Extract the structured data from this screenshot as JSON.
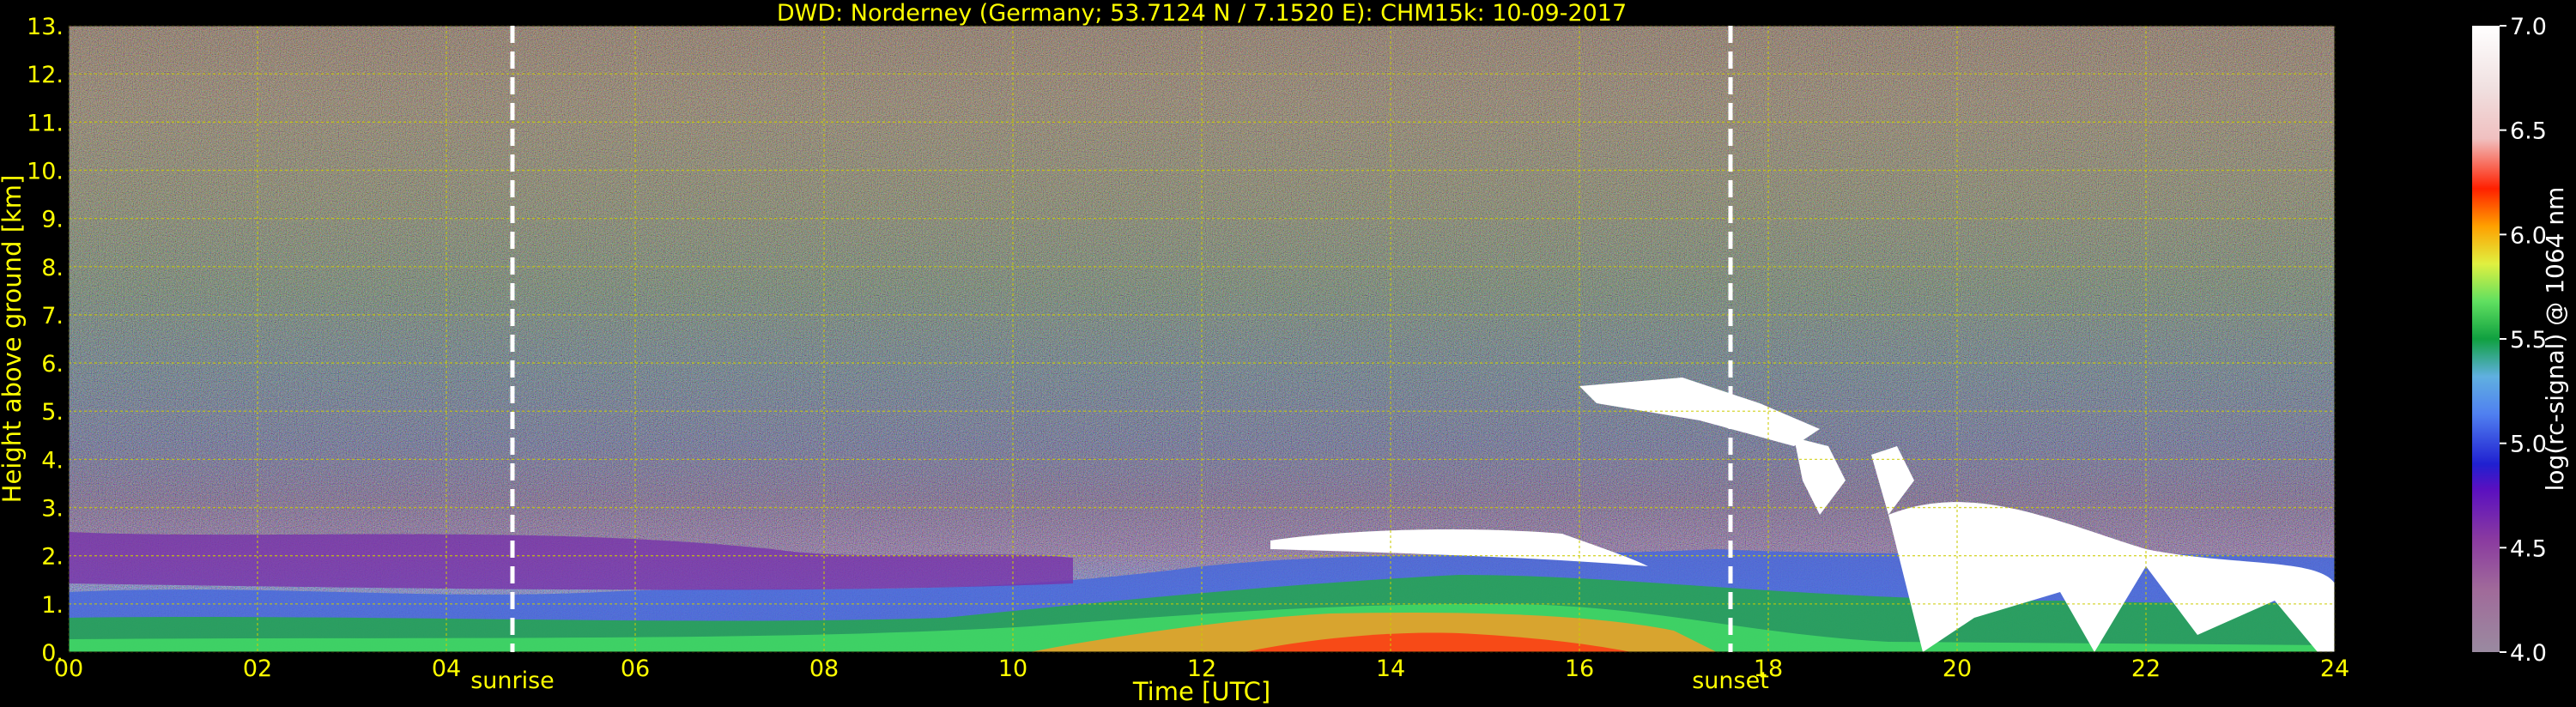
{
  "chart_data": {
    "type": "heatmap",
    "title": "DWD: Norderney (Germany; 53.7124 N / 7.1520 E):    CHM15k: 10-09-2017",
    "xlabel": "Time [UTC]",
    "ylabel": "Height above ground [km]",
    "xlim": [
      0,
      24
    ],
    "ylim": [
      0,
      13
    ],
    "x_ticks": [
      "00",
      "02",
      "04",
      "06",
      "08",
      "10",
      "12",
      "14",
      "16",
      "18",
      "20",
      "22",
      "24"
    ],
    "y_ticks": [
      "0.",
      "1.",
      "2.",
      "3.",
      "4.",
      "5.",
      "6.",
      "7.",
      "8.",
      "9.",
      "10.",
      "11.",
      "12.",
      "13."
    ],
    "grid": true,
    "events": [
      {
        "label": "sunrise",
        "x": 4.7
      },
      {
        "label": "sunset",
        "x": 17.6
      }
    ],
    "colorbar": {
      "label": "log(rc-signal) @ 1064 nm",
      "range": [
        4.0,
        7.0
      ],
      "ticks": [
        "4.0",
        "4.5",
        "5.0",
        "5.5",
        "6.0",
        "6.5",
        "7.0"
      ]
    },
    "colors": {
      "background": "#000000",
      "text": "#ffff00",
      "grid": "#cccc00",
      "event_line": "#ffffff",
      "colorbar_text": "#ffffff"
    }
  }
}
